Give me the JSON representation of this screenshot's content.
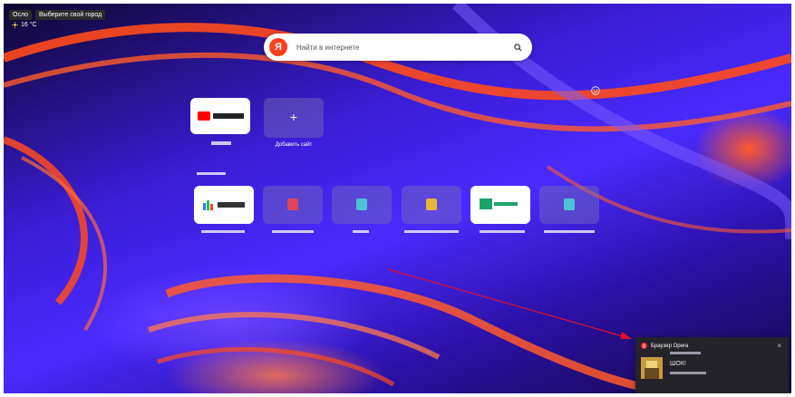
{
  "weather": {
    "location": "Осло",
    "city_prompt": "Выберите свой город",
    "temperature": "16 °C"
  },
  "search": {
    "logo": "Я",
    "placeholder": "Найти в интернете",
    "icon": "search-icon"
  },
  "top_sites": {
    "add_label": "Добавить сайт",
    "add_icon": "+"
  },
  "notification": {
    "source": "Браузер Opera",
    "message": "ШОК!",
    "close": "×"
  },
  "colors": {
    "yandex_red": "#fc3f1d",
    "opera_red": "#ff1b2d",
    "annotation_red": "#e0102a"
  }
}
